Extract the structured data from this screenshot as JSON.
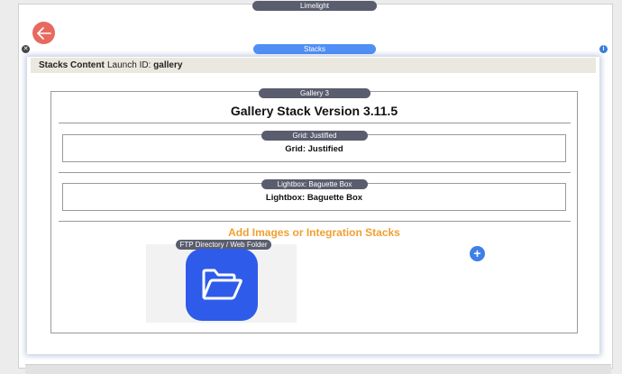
{
  "window": {
    "title": "Limelight"
  },
  "stacks_bar": {
    "label": "Stacks"
  },
  "content_header": {
    "title": "Stacks Content",
    "launch_label": "Launch ID:",
    "launch_id": "gallery"
  },
  "gallery": {
    "pill": "Gallery 3",
    "title": "Gallery Stack Version 3.11.5",
    "grid": {
      "pill": "Grid: Justified",
      "text": "Grid: Justified"
    },
    "lightbox": {
      "pill": "Lightbox: Baguette Box",
      "text": "Lightbox: Baguette Box"
    },
    "add_images": "Add Images or Integration Stacks",
    "ftp": {
      "pill": "FTP Directory / Web Folder"
    }
  },
  "icons": {
    "back": "back-arrow-icon",
    "close": "close-icon",
    "info": "info-icon",
    "folder": "open-folder-icon",
    "add": "plus-icon"
  },
  "colors": {
    "back_button": "#e8695f",
    "stacks_pill": "#4f8ff7",
    "dark_pill": "#5a5d6d",
    "accent_orange": "#f0a030",
    "folder_tile": "#2f5bea",
    "add_button": "#3f7fe8"
  }
}
